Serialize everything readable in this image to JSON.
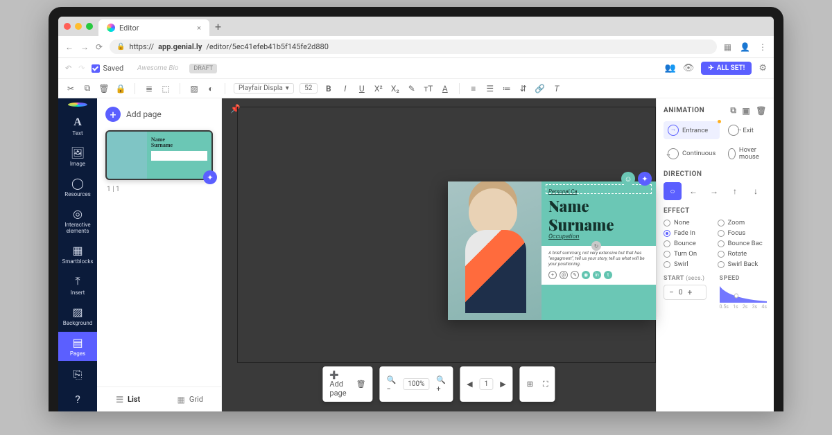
{
  "browser": {
    "tab_title": "Editor",
    "url_prefix": "https://",
    "url_bold": "app.genial.ly",
    "url_rest": "/editor/5ec41efeb41b5f145fe2d880"
  },
  "app_top": {
    "saved": "Saved",
    "title_placeholder": "Awesome Bio",
    "draft": "DRAFT",
    "allset": "ALL SET!"
  },
  "toolbar": {
    "font": "Playfair Displa",
    "size": "52"
  },
  "sidenav": {
    "items": [
      {
        "icon": "A",
        "label": "Text"
      },
      {
        "icon": "🖼",
        "label": "Image"
      },
      {
        "icon": "◯◯",
        "label": "Resources"
      },
      {
        "icon": "◎",
        "label": "Interactive elements"
      },
      {
        "icon": "▦",
        "label": "Smartblocks"
      },
      {
        "icon": "⤒",
        "label": "Insert"
      },
      {
        "icon": "▨",
        "label": "Background"
      },
      {
        "icon": "▤",
        "label": "Pages"
      }
    ],
    "bottom": [
      {
        "icon": "⎘"
      },
      {
        "icon": "?"
      }
    ]
  },
  "pages": {
    "add": "Add page",
    "counter": "1 | 1",
    "thumb": {
      "name1": "Name",
      "name2": "Surname"
    },
    "views": {
      "list": "List",
      "grid": "Grid"
    }
  },
  "canvas": {
    "card": {
      "tag": "Personal Ca",
      "line1": "Name",
      "line2": "Surname",
      "occupation": "Occupation",
      "desc": "A brief summary, not very extensive but that has \"engagment\", tell us your story, tell us what will be your positioning."
    },
    "bottom": {
      "addpage": "Add page",
      "zoom": "100%",
      "page": "1"
    }
  },
  "anim": {
    "title": "ANIMATION",
    "modes": [
      {
        "label": "Entrance",
        "active": true,
        "dot": true
      },
      {
        "label": "Exit"
      },
      {
        "label": "Continuous"
      },
      {
        "label": "Hover mouse"
      }
    ],
    "direction_title": "DIRECTION",
    "effect_title": "EFFECT",
    "effects": [
      {
        "label": "None"
      },
      {
        "label": "Zoom"
      },
      {
        "label": "Fade In",
        "sel": true
      },
      {
        "label": "Focus"
      },
      {
        "label": "Bounce"
      },
      {
        "label": "Bounce Bac"
      },
      {
        "label": "Turn On"
      },
      {
        "label": "Rotate"
      },
      {
        "label": "Swirl"
      },
      {
        "label": "Swirl Back"
      }
    ],
    "start_title": "START",
    "start_unit": "(secs.)",
    "start_value": "0",
    "speed_title": "SPEED",
    "speed_ticks": [
      "0.5s",
      "1s",
      "2s",
      "3s",
      "4s"
    ]
  }
}
